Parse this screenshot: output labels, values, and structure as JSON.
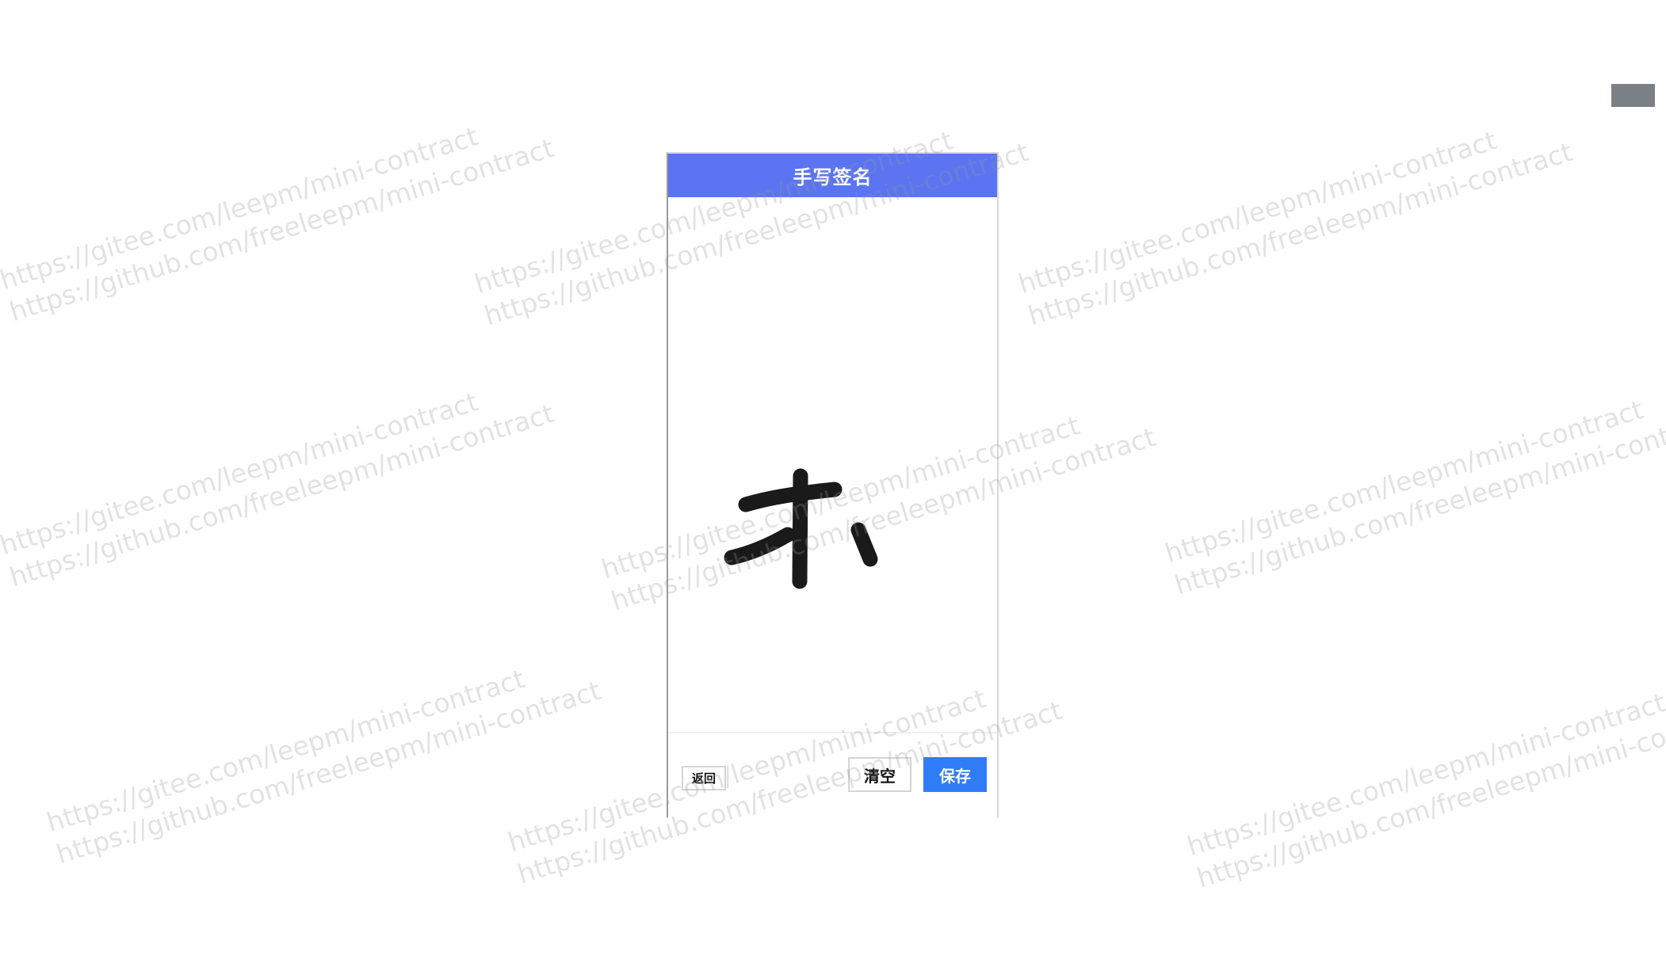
{
  "header": {
    "title": "手写签名"
  },
  "footer": {
    "back_label": "返回",
    "clear_label": "清空",
    "save_label": "保存"
  },
  "watermark": {
    "line1": "https://gitee.com/leepm/mini-contract",
    "line2": "https://github.com/freeleepm/mini-contract"
  },
  "colors": {
    "header_bg": "#5a74f2",
    "save_bg": "#2f7cf6",
    "ink": "#1a1a1a",
    "corner_chip": "#7b8086"
  },
  "icons": {
    "signature_stroke": "handwritten-signature"
  }
}
